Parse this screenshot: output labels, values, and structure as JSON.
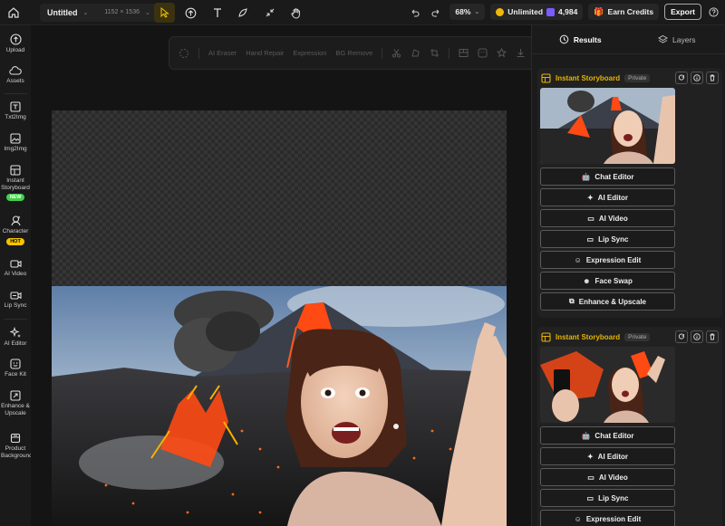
{
  "topbar": {
    "doc_title": "Untitled",
    "doc_size": "1152 × 1536",
    "zoom": "68%",
    "plan": "Unlimited",
    "credits": "4,984",
    "earn_credits": "Earn Credits",
    "export": "Export"
  },
  "sidebar": {
    "items": [
      {
        "label": "Upload",
        "icon": "upload-icon"
      },
      {
        "label": "Assets",
        "icon": "cloud-icon"
      },
      {
        "label": "Txt2Img",
        "icon": "text-image-icon"
      },
      {
        "label": "Img2Img",
        "icon": "image-icon"
      },
      {
        "label": "Instant Storyboard",
        "icon": "storyboard-icon",
        "badge": "NEW"
      },
      {
        "label": "Character",
        "icon": "character-icon",
        "badge": "HOT"
      },
      {
        "label": "AI Video",
        "icon": "video-icon"
      },
      {
        "label": "Lip Sync",
        "icon": "lip-sync-icon"
      },
      {
        "label": "AI Editor",
        "icon": "sparkle-icon"
      },
      {
        "label": "Face Kit",
        "icon": "face-icon"
      },
      {
        "label": "Enhance & Upscale",
        "icon": "enhance-icon"
      },
      {
        "label": "Product Background",
        "icon": "product-icon"
      }
    ]
  },
  "floating_toolbar": {
    "labels": [
      "AI Eraser",
      "Hand Repair",
      "Expression",
      "BG Remove"
    ]
  },
  "right_panel": {
    "tabs": [
      {
        "label": "Results",
        "icon": "history-icon"
      },
      {
        "label": "Layers",
        "icon": "layers-icon"
      }
    ],
    "cards": [
      {
        "title": "Instant Storyboard",
        "visibility": "Private",
        "actions": [
          "Chat Editor",
          "AI Editor",
          "AI Video",
          "Lip Sync",
          "Expression Edit",
          "Face Swap",
          "Enhance & Upscale"
        ]
      },
      {
        "title": "Instant Storyboard",
        "visibility": "Private",
        "actions": [
          "Chat Editor",
          "AI Editor",
          "AI Video",
          "Lip Sync",
          "Expression Edit"
        ]
      }
    ]
  },
  "colors": {
    "accent": "#e6b400",
    "new_badge": "#3fd14a",
    "hot_badge": "#f5c400",
    "lava": "#ff4a14"
  }
}
